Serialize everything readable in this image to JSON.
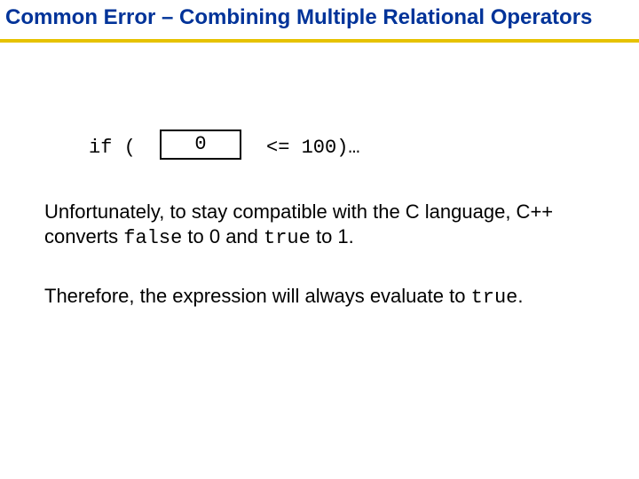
{
  "title": "Common Error –  Combining Multiple Relational Operators",
  "code": {
    "if_open": "if (",
    "boxed": "0",
    "tail": "<= 100)…"
  },
  "p1": {
    "a": "Unfortunately, to stay compatible with the C language, C++ converts ",
    "false_kw": "false",
    "b": " to 0 and ",
    "true_kw": "true",
    "c": " to 1."
  },
  "p2": {
    "a": "Therefore, the expression will always evaluate to ",
    "true_kw": "true",
    "b": "."
  }
}
